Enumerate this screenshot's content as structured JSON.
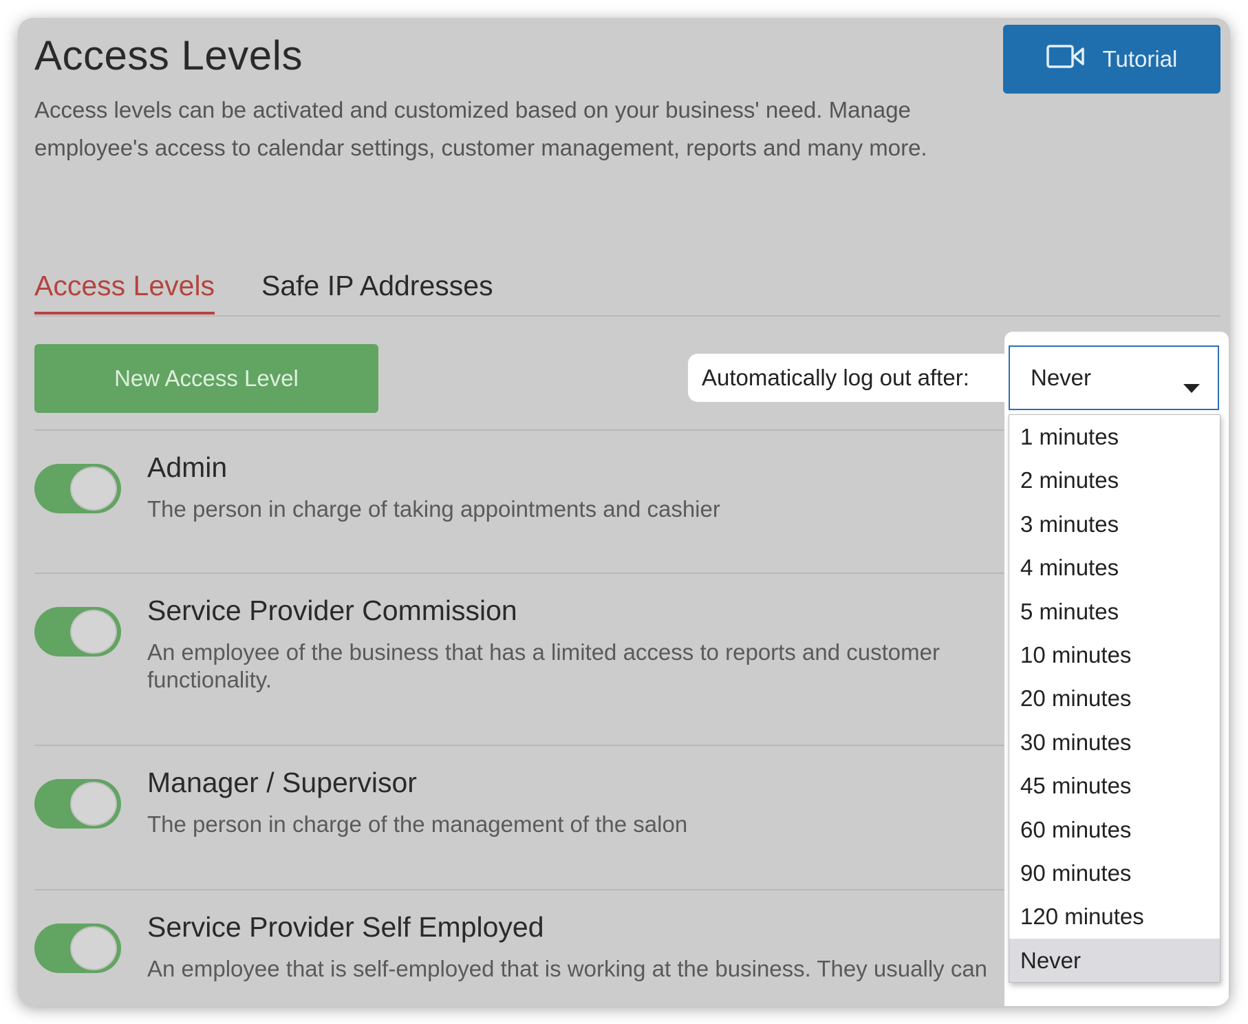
{
  "header": {
    "title": "Access Levels",
    "subtitle": "Access levels can be activated and customized based on your business' need. Manage employee's access to calendar settings, customer management, reports and many more.",
    "tutorial_label": "Tutorial"
  },
  "tabs": [
    {
      "label": "Access Levels",
      "active": true
    },
    {
      "label": "Safe IP Addresses",
      "active": false
    }
  ],
  "toolbar": {
    "new_button_label": "New Access Level",
    "logout_label": "Automatically log out after:",
    "logout_value": "Never"
  },
  "dropdown": {
    "options": [
      "1 minutes",
      "2 minutes",
      "3 minutes",
      "4 minutes",
      "5 minutes",
      "10 minutes",
      "20 minutes",
      "30 minutes",
      "45 minutes",
      "60 minutes",
      "90 minutes",
      "120 minutes",
      "Never"
    ],
    "selected": "Never"
  },
  "levels": [
    {
      "name": "Admin",
      "description": "The person in charge of taking appointments and cashier",
      "enabled": true
    },
    {
      "name": "Service Provider Commission",
      "description": "An employee of the business that has a limited access to reports and customer functionality.",
      "enabled": true
    },
    {
      "name": "Manager / Supervisor",
      "description": "The person in charge of the management of the salon",
      "enabled": true
    },
    {
      "name": "Service Provider Self Employed",
      "description": "An employee that is self-employed that is working at the business. They usually can",
      "enabled": true
    }
  ],
  "colors": {
    "accent_tab": "#b5443f",
    "tutorial_button": "#1f6fae",
    "new_button": "#62a462",
    "toggle_on": "#62a462"
  }
}
